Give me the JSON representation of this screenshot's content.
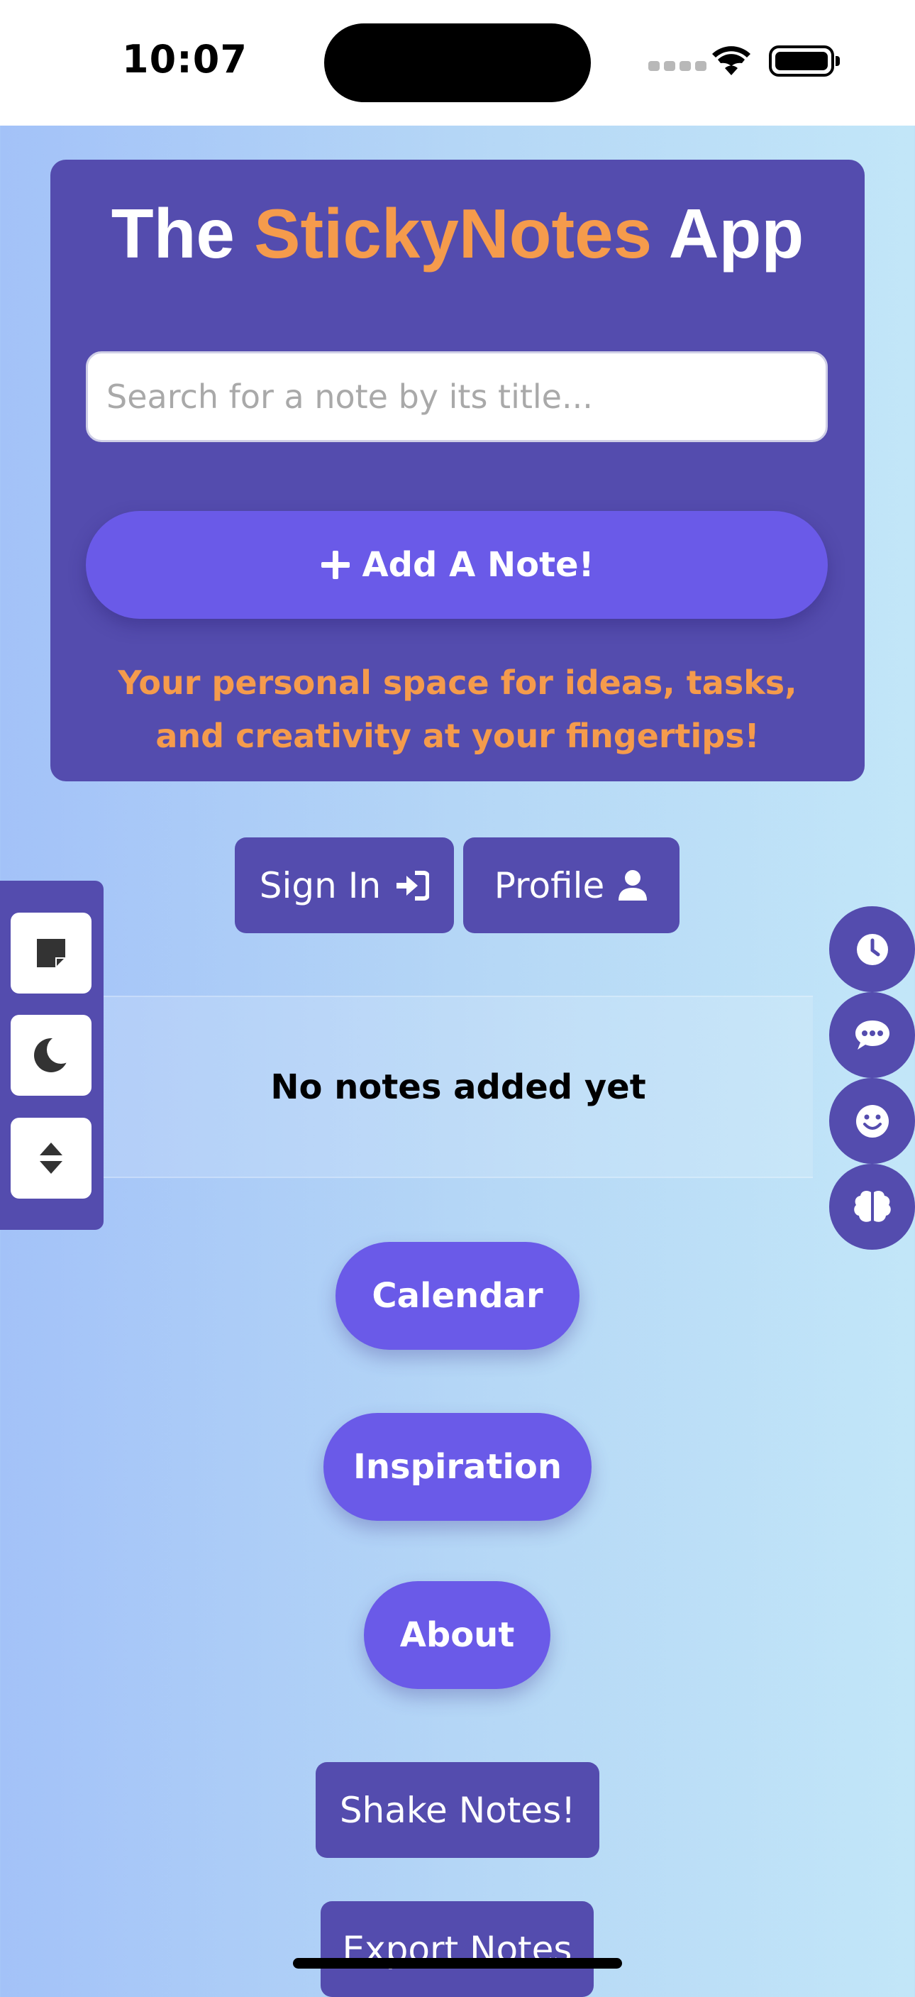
{
  "status_bar": {
    "time": "10:07"
  },
  "header": {
    "title_prefix": "The ",
    "title_accent": "StickyNotes",
    "title_suffix": " App",
    "search_placeholder": "Search for a note by its title...",
    "add_note_label": "Add A Note!",
    "tagline": "Your personal space for ideas, tasks, and creativity at your fingertips!"
  },
  "auth": {
    "sign_in_label": "Sign In",
    "profile_label": "Profile"
  },
  "side_tools": [
    "sticky-note-icon",
    "moon-icon",
    "sort-icon"
  ],
  "right_fabs": [
    "clock-icon",
    "chat-icon",
    "smile-icon",
    "brain-icon"
  ],
  "notes": {
    "empty_message": "No notes added yet"
  },
  "nav": {
    "calendar_label": "Calendar",
    "inspiration_label": "Inspiration",
    "about_label": "About",
    "shake_label": "Shake Notes!",
    "export_label": "Export Notes"
  },
  "colors": {
    "panel": "#544cae",
    "accent_orange": "#f59b4c",
    "button_purple": "#6a5ae8",
    "bg_left": "#a3c2f8",
    "bg_right": "#c2e6f8"
  }
}
